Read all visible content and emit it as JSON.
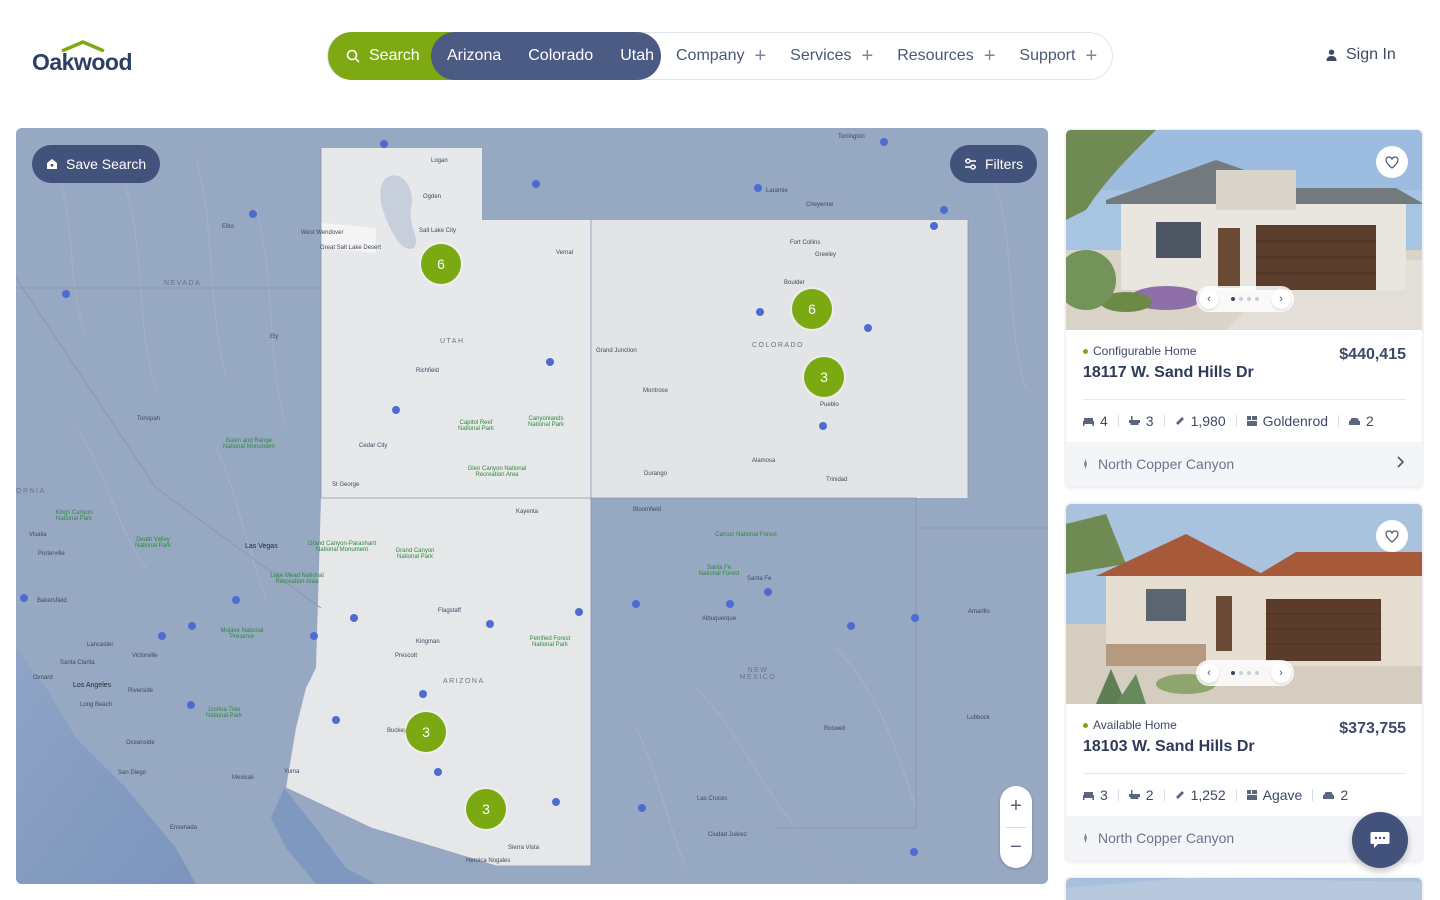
{
  "brand": {
    "name": "Oakwood",
    "color": "#2d3f63",
    "accent": "#7ea913"
  },
  "nav": {
    "search_label": "Search",
    "states": [
      "Arizona",
      "Colorado",
      "Utah"
    ],
    "links": [
      "Company",
      "Services",
      "Resources",
      "Support"
    ],
    "signin_label": "Sign In"
  },
  "map": {
    "save_search_label": "Save Search",
    "filters_label": "Filters",
    "clusters": [
      "6",
      "6",
      "3",
      "3",
      "3"
    ],
    "region_labels": {
      "nevada": "NEVADA",
      "utah": "UTAH",
      "colorado": "COLORADO",
      "arizona": "ARIZONA",
      "new_mexico": "NEW MEXICO",
      "california": "ORNIA"
    },
    "city_labels": {
      "logan": "Logan",
      "ogden": "Ogden",
      "slc": "Salt Lake City",
      "wendover": "West Wendover",
      "gsl_desert": "Great Salt Lake Desert",
      "fort_collins": "Fort Collins",
      "greeley": "Greeley",
      "boulder": "Boulder",
      "grand_junction": "Grand Junction",
      "pueblo": "Pueblo",
      "cheyenne": "Cheyenne",
      "laramie": "Laramie",
      "torrington": "Torrington",
      "st_george": "St George",
      "cedar_city": "Cedar City",
      "richfield": "Richfield",
      "las_vegas": "Las Vegas",
      "flagstaff": "Flagstaff",
      "prescott": "Prescott",
      "los_angeles": "Los Angeles",
      "long_beach": "Long Beach",
      "riverside": "Riverside",
      "san_diego": "San Diego",
      "bakersfield": "Bakersfield",
      "albuquerque": "Albuquerque",
      "santa_fe": "Santa Fe",
      "ciudad_juarez": "Ciudad Juárez",
      "las_cruces": "Las Cruces",
      "amarillo": "Amarillo",
      "lubbock": "Lubbock",
      "roswell": "Roswell",
      "durango": "Durango",
      "bloomfield": "Bloomfield",
      "kayenta": "Kayenta",
      "sierra_vista": "Sierra Vista",
      "nogales": "Heroica Nogales",
      "mexicali": "Mexicali",
      "ensenada": "Ensenada",
      "trinidad": "Trinidad",
      "alamosa": "Alamosa",
      "montrose": "Montrose",
      "vernal": "Vernal",
      "elko": "Elko",
      "ely": "Ely",
      "tonopah": "Tonopah",
      "victorville": "Victorville",
      "lancaster": "Lancaster",
      "kingman": "Kingman",
      "buckeye": "Buckeye",
      "visalia": "Visalia",
      "porterville": "Porterville",
      "santa_clarita": "Santa Clarita",
      "oxnard": "Oxnard",
      "oceanside": "Oceanside",
      "yuma": "Yuma"
    },
    "park_labels": {
      "capitol_reef": "Capitol Reef National Park",
      "canyonlands": "Canyonlands National Park",
      "glen_canyon": "Glen Canyon National Recreation Area",
      "great_basin": "Basin and Range National Monument",
      "grand_canyon": "Grand Canyon National Park",
      "parashant": "Grand Canyon-Parashant National Monument",
      "lake_mead": "Lake Mead National Recreation Area",
      "mojave": "Mojave National Preserve",
      "joshua_tree": "Joshua Tree National Park",
      "death_valley": "Death Valley National Park",
      "kings_canyon": "Kings Canyon National Park",
      "petrified": "Petrified Forest National Park",
      "carson": "Carson National Forest",
      "santa_fe_nf": "Santa Fe National Forest"
    },
    "zoom_in": "+",
    "zoom_out": "−"
  },
  "listings": [
    {
      "status": "Configurable Home",
      "price": "$440,415",
      "address": "18117 W. Sand Hills Dr",
      "beds": "4",
      "baths": "3",
      "sqft": "1,980",
      "plan": "Goldenrod",
      "garage": "2",
      "community": "North Copper Canyon"
    },
    {
      "status": "Available Home",
      "price": "$373,755",
      "address": "18103 W. Sand Hills Dr",
      "beds": "3",
      "baths": "2",
      "sqft": "1,252",
      "plan": "Agave",
      "garage": "2",
      "community": "North Copper Canyon"
    }
  ]
}
